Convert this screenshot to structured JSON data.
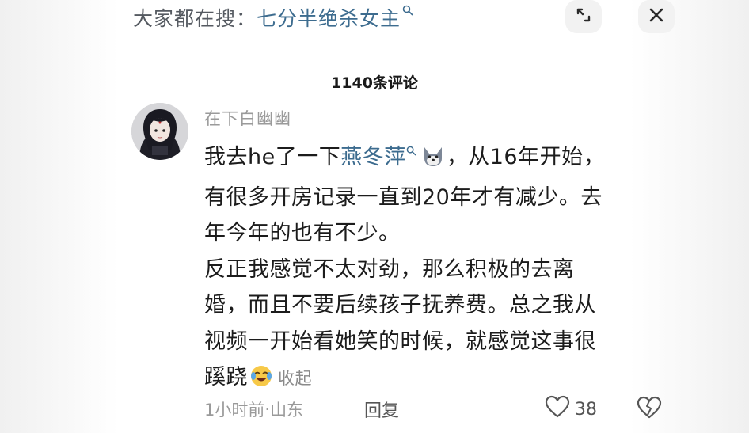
{
  "search": {
    "prefix": "大家都在搜：",
    "term": "七分半绝杀女主"
  },
  "icons": {
    "search_suggest": "magnifier-icon",
    "expand": "expand-icon",
    "close": "close-icon",
    "like": "heart-icon",
    "dislike": "broken-heart-icon"
  },
  "header": {
    "comment_count": "1140条评论"
  },
  "comment": {
    "username": "在下白幽幽",
    "text_before_link": "我去he了一下",
    "link_text": "燕冬萍",
    "text_after_emoji": "，从16年开始，",
    "line2": "有很多开房记录一直到20年才有减少。去",
    "line3": "年今年的也有不少。",
    "line4": "反正我感觉不太对劲，那么积极的去离",
    "line5": "婚，而且不要后续孩子抚养费。总之我从",
    "line6": "视频一开始看她笑的时候，就感觉这事很",
    "line7": "蹊跷",
    "collapse_label": "收起",
    "time": "1小时前",
    "separator": " · ",
    "location": "山东",
    "reply_label": "回复",
    "likes": "38"
  },
  "colors": {
    "link": "#3d6c8f",
    "muted": "#9a9a9a",
    "text": "#1c1c1c"
  }
}
